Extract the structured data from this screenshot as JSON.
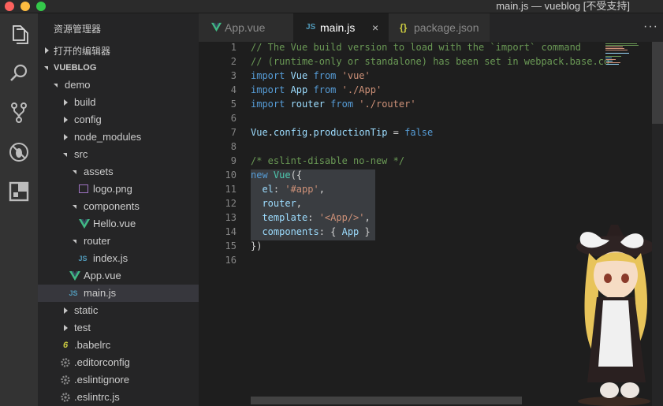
{
  "window": {
    "title": "main.js — vueblog [不受支持]"
  },
  "activity_bar": {
    "items": [
      "files-icon",
      "search-icon",
      "source-control-icon",
      "debug-icon",
      "extensions-icon"
    ]
  },
  "explorer": {
    "title": "资源管理器",
    "open_editors": "打开的编辑器",
    "project": "VUEBLOG",
    "tree": [
      {
        "label": "demo",
        "kind": "folder-open"
      },
      {
        "label": "build",
        "kind": "folder"
      },
      {
        "label": "config",
        "kind": "folder"
      },
      {
        "label": "node_modules",
        "kind": "folder"
      },
      {
        "label": "src",
        "kind": "folder-open"
      },
      {
        "label": "assets",
        "kind": "folder-open"
      },
      {
        "label": "logo.png",
        "kind": "image"
      },
      {
        "label": "components",
        "kind": "folder-open"
      },
      {
        "label": "Hello.vue",
        "kind": "vue"
      },
      {
        "label": "router",
        "kind": "folder-open"
      },
      {
        "label": "index.js",
        "kind": "js"
      },
      {
        "label": "App.vue",
        "kind": "vue"
      },
      {
        "label": "main.js",
        "kind": "js"
      },
      {
        "label": "static",
        "kind": "folder"
      },
      {
        "label": "test",
        "kind": "folder"
      },
      {
        "label": ".babelrc",
        "kind": "babel"
      },
      {
        "label": ".editorconfig",
        "kind": "gear"
      },
      {
        "label": ".eslintignore",
        "kind": "gear"
      },
      {
        "label": ".eslintrc.js",
        "kind": "gear"
      }
    ]
  },
  "tabs": [
    {
      "label": "App.vue",
      "icon": "V"
    },
    {
      "label": "main.js",
      "icon": "JS"
    },
    {
      "label": "package.json",
      "icon": "{}"
    }
  ],
  "tab_close": "×",
  "more_actions": "···",
  "colors": {
    "vue": "#41b883",
    "js": "#519aba",
    "json": "#cbcb41",
    "accent": "#007acc"
  },
  "editor": {
    "lines": [
      [
        {
          "t": "// The Vue build version to load with the `import` command",
          "c": "com"
        }
      ],
      [
        {
          "t": "// (runtime-only or standalone) has been set in webpack.base.co",
          "c": "com"
        }
      ],
      [
        {
          "t": "import ",
          "c": "kw"
        },
        {
          "t": "Vue",
          "c": "var"
        },
        {
          "t": " from ",
          "c": "kw"
        },
        {
          "t": "'vue'",
          "c": "str"
        }
      ],
      [
        {
          "t": "import ",
          "c": "kw"
        },
        {
          "t": "App",
          "c": "var"
        },
        {
          "t": " from ",
          "c": "kw"
        },
        {
          "t": "'./App'",
          "c": "str"
        }
      ],
      [
        {
          "t": "import ",
          "c": "kw"
        },
        {
          "t": "router",
          "c": "var"
        },
        {
          "t": " from ",
          "c": "kw"
        },
        {
          "t": "'./router'",
          "c": "str"
        }
      ],
      [],
      [
        {
          "t": "Vue",
          "c": "var"
        },
        {
          "t": ".",
          "c": "pun"
        },
        {
          "t": "config",
          "c": "var"
        },
        {
          "t": ".",
          "c": "pun"
        },
        {
          "t": "productionTip",
          "c": "var"
        },
        {
          "t": " = ",
          "c": "pun"
        },
        {
          "t": "false",
          "c": "kw"
        }
      ],
      [],
      [
        {
          "t": "/* eslint-disable no-new */",
          "c": "com"
        }
      ],
      [
        {
          "t": "new ",
          "c": "kw"
        },
        {
          "t": "Vue",
          "c": "cls"
        },
        {
          "t": "({",
          "c": "pun"
        }
      ],
      [
        {
          "t": "  el",
          "c": "var"
        },
        {
          "t": ": ",
          "c": "pun"
        },
        {
          "t": "'#app'",
          "c": "str"
        },
        {
          "t": ",",
          "c": "pun"
        }
      ],
      [
        {
          "t": "  router",
          "c": "var"
        },
        {
          "t": ",",
          "c": "pun"
        }
      ],
      [
        {
          "t": "  template",
          "c": "var"
        },
        {
          "t": ": ",
          "c": "pun"
        },
        {
          "t": "'<App/>'",
          "c": "str"
        },
        {
          "t": ",",
          "c": "pun"
        }
      ],
      [
        {
          "t": "  components",
          "c": "var"
        },
        {
          "t": ": { ",
          "c": "pun"
        },
        {
          "t": "App",
          "c": "var"
        },
        {
          "t": " }",
          "c": "pun"
        }
      ],
      [
        {
          "t": "})",
          "c": "pun"
        }
      ],
      []
    ]
  }
}
